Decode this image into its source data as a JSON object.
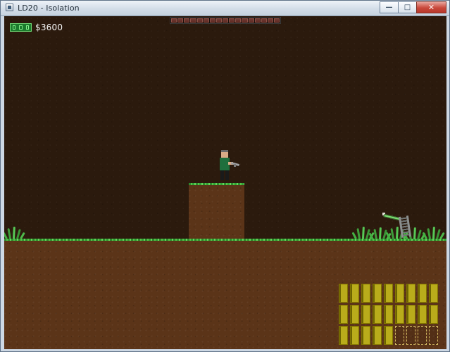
{
  "window": {
    "title": "LD20 - Isolation",
    "minimize_glyph": "—",
    "maximize_glyph": "□",
    "close_glyph": "✕"
  },
  "hud": {
    "cash_text": "$3600",
    "cash_icon": "money-icon",
    "health_segments": 17,
    "ammo": {
      "total_slots": 27,
      "full_slots": 23
    }
  },
  "colors": {
    "background": "#2b1a0d",
    "ground": "#5b3418",
    "grass": "#4db548",
    "health": "#744039",
    "ammo": "#b9ac1b"
  },
  "icons": {
    "window": "window-icon",
    "minimize": "minimize-icon",
    "maximize": "maximize-icon",
    "close": "close-icon"
  }
}
